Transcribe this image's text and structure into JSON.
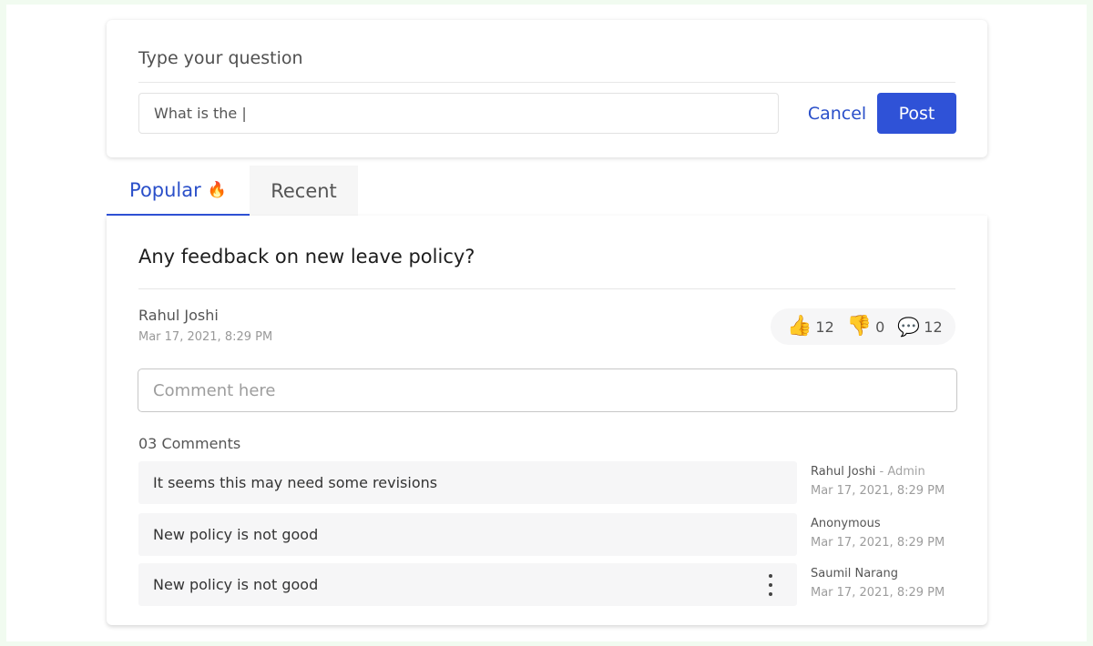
{
  "ask": {
    "title": "Type your question",
    "input_value": "What is the |",
    "cancel_label": "Cancel",
    "post_label": "Post"
  },
  "tabs": [
    {
      "label": "Popular",
      "icon": "flame-icon",
      "active": true
    },
    {
      "label": "Recent",
      "active": false
    }
  ],
  "post": {
    "title": "Any feedback on new leave policy?",
    "author": "Rahul Joshi",
    "date": "Mar 17, 2021, 8:29 PM",
    "reactions": {
      "likes": "12",
      "dislikes": "0",
      "comments": "12"
    },
    "comment_placeholder": "Comment here",
    "comments_count_label": "03 Comments",
    "comments": [
      {
        "text": "It seems this may need some revisions",
        "author": "Rahul Joshi",
        "role": " - Admin",
        "date": "Mar 17, 2021, 8:29 PM"
      },
      {
        "text": "New policy is not good",
        "author": "Anonymous",
        "role": "",
        "date": "Mar 17, 2021, 8:29 PM"
      },
      {
        "text": "New policy is not good",
        "author": "Saumil Narang",
        "role": "",
        "date": "Mar 17, 2021, 8:29 PM"
      }
    ]
  }
}
